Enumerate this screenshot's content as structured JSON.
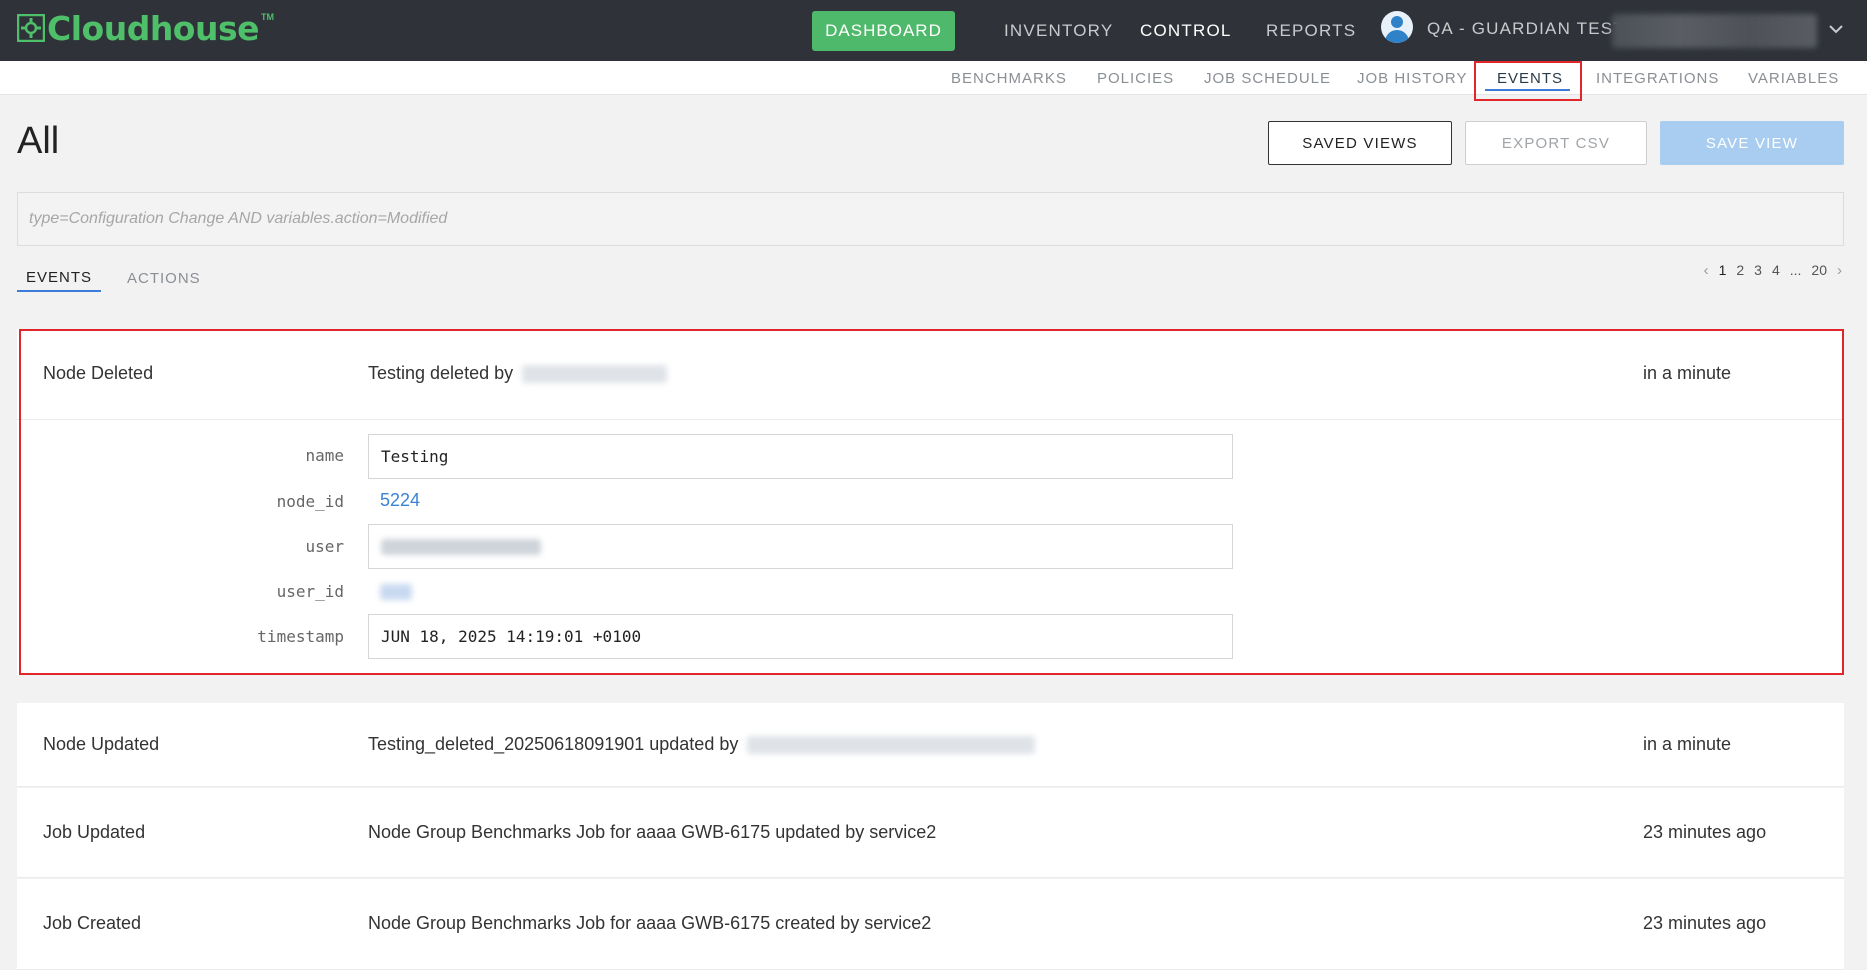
{
  "header": {
    "logo_text": "Cloudhouse",
    "logo_tm": "TM",
    "dashboard_label": "DASHBOARD",
    "nav": [
      "INVENTORY",
      "CONTROL",
      "REPORTS"
    ],
    "active_nav": "CONTROL",
    "user_label": "QA - GUARDIAN TEST",
    "brand_color": "#4fbf6a",
    "bar_color": "#2f3339"
  },
  "subnav": {
    "items": [
      "BENCHMARKS",
      "POLICIES",
      "JOB SCHEDULE",
      "JOB HISTORY",
      "EVENTS",
      "INTEGRATIONS",
      "VARIABLES"
    ],
    "active": "EVENTS"
  },
  "page": {
    "title": "All",
    "saved_views_label": "SAVED VIEWS",
    "export_csv_label": "EXPORT CSV",
    "save_view_label": "SAVE VIEW",
    "query_placeholder": "type=Configuration Change AND variables.action=Modified"
  },
  "tabs": {
    "events_label": "EVENTS",
    "actions_label": "ACTIONS"
  },
  "pagination": {
    "prev": "‹",
    "pages": [
      "1",
      "2",
      "3",
      "4",
      "...",
      "20"
    ],
    "current": "1",
    "next": "›"
  },
  "expanded_event": {
    "type": "Node Deleted",
    "description": "Testing deleted by",
    "time": "in a minute",
    "fields": {
      "name_label": "name",
      "name_value": "Testing",
      "node_id_label": "node_id",
      "node_id_value": "5224",
      "user_label": "user",
      "user_id_label": "user_id",
      "timestamp_label": "timestamp",
      "timestamp_value": "JUN 18, 2025 14:19:01 +0100"
    }
  },
  "events": [
    {
      "type": "Node Updated",
      "description": "Testing_deleted_20250618091901 updated by",
      "time": "in a minute"
    },
    {
      "type": "Job Updated",
      "description": "Node Group Benchmarks Job for aaaa GWB-6175 updated by service2",
      "time": "23 minutes ago"
    },
    {
      "type": "Job Created",
      "description": "Node Group Benchmarks Job for aaaa GWB-6175 created by service2",
      "time": "23 minutes ago"
    }
  ],
  "colors": {
    "highlight": "#e0262a",
    "accent": "#3b7dd8",
    "dashboard_button": "#4fb96b",
    "save_view_button": "#a9cdf0"
  }
}
